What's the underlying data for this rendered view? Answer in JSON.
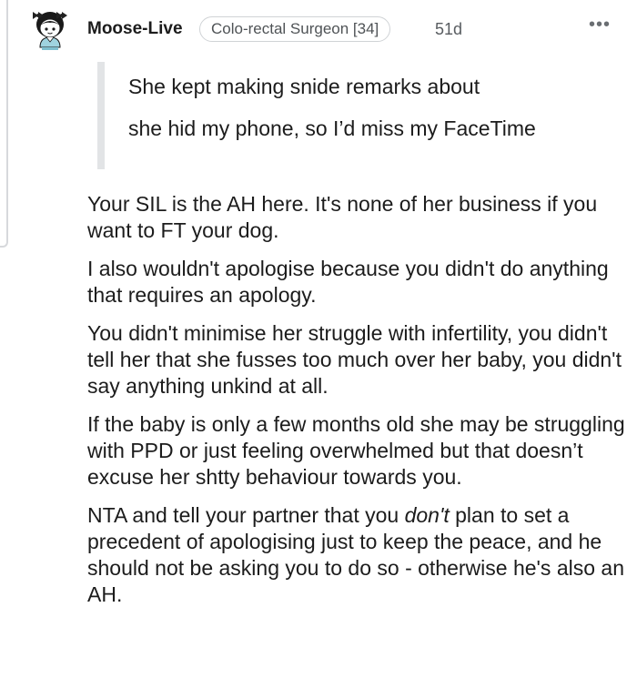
{
  "comment": {
    "author": "Moose-Live",
    "flair": "Colo-rectal Surgeon [34]",
    "age": "51d",
    "more_icon": "more-dots-icon",
    "avatar_icon": "snoo-avatar-icon",
    "quote": [
      "She kept making snide remarks about",
      "she hid my phone, so I’d miss my FaceTime"
    ],
    "paragraphs": [
      "Your SIL is the AH here. It's none of her business if you want to FT your dog.",
      "I also wouldn't apologise because you didn't do anything that requires an apology.",
      "You didn't minimise her struggle with infertility, you didn't tell her that she fusses too much over her baby, you didn't say anything unkind at all.",
      "If the baby is only a few months old she may be struggling with PPD or just feeling overwhelmed but that doesn’t excuse her shtty behaviour towards you."
    ],
    "last_paragraph": {
      "before": "NTA and tell your partner that you ",
      "emphasis": "don't",
      "after": " plan to set a precedent of apologising just to keep the peace, and he should not be asking you to do so - otherwise he's also an AH."
    }
  },
  "colors": {
    "text": "#1c1c1c",
    "meta": "#585c60",
    "quote_bar": "#e2e4e6",
    "flair_border": "#d0d3d6",
    "thread_line": "#d7d9dc"
  }
}
